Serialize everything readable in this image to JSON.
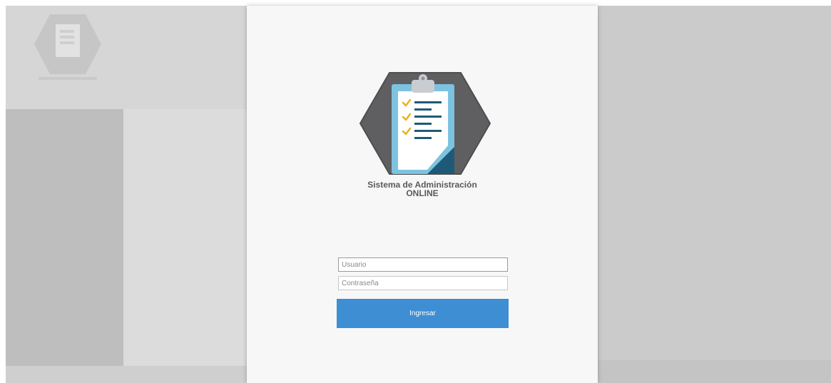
{
  "app": {
    "title": "Sistema de Administración",
    "subtitle": "ONLINE"
  },
  "login": {
    "username_placeholder": "Usuario",
    "password_placeholder": "Contraseña",
    "submit_label": "Ingresar"
  },
  "colors": {
    "accent": "#3d8ed3",
    "logo_hexagon": "#5f5f61",
    "clipboard_board": "#7dc3e0",
    "clipboard_paper": "#ffffff",
    "clipboard_clip": "#c9ccd0",
    "check": "#e8b320",
    "line": "#1e5a78"
  },
  "icons": {
    "logo": "clipboard-checklist-icon"
  }
}
